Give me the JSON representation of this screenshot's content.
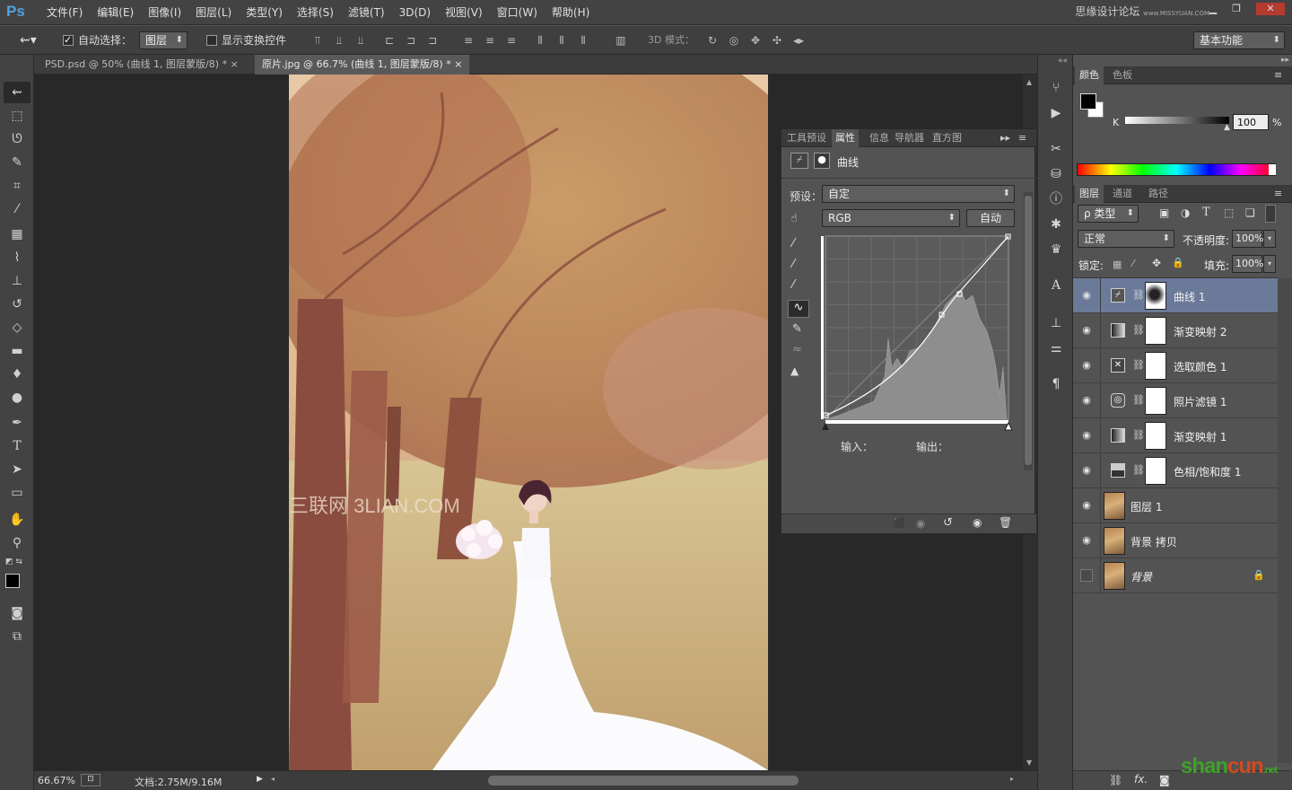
{
  "app": {
    "logo": "Ps"
  },
  "menu": [
    "文件(F)",
    "编辑(E)",
    "图像(I)",
    "图层(L)",
    "类型(Y)",
    "选择(S)",
    "滤镜(T)",
    "3D(D)",
    "视图(V)",
    "窗口(W)",
    "帮助(H)"
  ],
  "watermark": {
    "text": "思缘设计论坛",
    "small": "www.MISSYUAN.COM"
  },
  "options": {
    "auto_select_label": "自动选择：",
    "auto_select_target": "图层",
    "show_transform_label": "显示变换控件",
    "mode3d_label": "3D 模式：",
    "workspace": "基本功能"
  },
  "doc_tabs": [
    {
      "label": "PSD.psd @ 50% (曲线 1, 图层蒙版/8) *"
    },
    {
      "label": "原片.jpg @ 66.7% (曲线 1, 图层蒙版/8) *"
    }
  ],
  "canvas": {
    "watermark_text": "三联网 3LIAN.COM"
  },
  "status": {
    "zoom": "66.67%",
    "doc": "文档:2.75M/9.16M"
  },
  "properties": {
    "tabs": [
      "工具预设",
      "属性",
      "信息",
      "导航器",
      "直方图"
    ],
    "title": "曲线",
    "preset_label": "预设：",
    "preset_value": "自定",
    "channel": "RGB",
    "auto_button": "自动",
    "input_label": "输入：",
    "output_label": "输出："
  },
  "color_panel": {
    "tabs": [
      "颜色",
      "色板"
    ],
    "channel_label": "K",
    "value": "100",
    "unit": "%"
  },
  "layers_panel": {
    "tabs": [
      "图层",
      "通道",
      "路径"
    ],
    "filter": "ρ 类型",
    "blend_mode": "正常",
    "opacity_label": "不透明度:",
    "opacity_value": "100%",
    "lock_label": "锁定:",
    "fill_label": "填充:",
    "fill_value": "100%",
    "layers": [
      {
        "name": "曲线 1",
        "kind": "adjustment",
        "icon": "curves-icon",
        "selected": true,
        "visible": true
      },
      {
        "name": "渐变映射 2",
        "kind": "adjustment",
        "icon": "gradient-map-icon",
        "selected": false,
        "visible": true
      },
      {
        "name": "选取颜色 1",
        "kind": "adjustment",
        "icon": "selective-color-icon",
        "selected": false,
        "visible": true
      },
      {
        "name": "照片滤镜 1",
        "kind": "adjustment",
        "icon": "photo-filter-icon",
        "selected": false,
        "visible": true
      },
      {
        "name": "渐变映射 1",
        "kind": "adjustment",
        "icon": "gradient-map-icon",
        "selected": false,
        "visible": true
      },
      {
        "name": "色相/饱和度 1",
        "kind": "adjustment",
        "icon": "hue-saturation-icon",
        "selected": false,
        "visible": true
      },
      {
        "name": "图层 1",
        "kind": "pixel",
        "selected": false,
        "visible": true
      },
      {
        "name": "背景 拷贝",
        "kind": "pixel",
        "selected": false,
        "visible": true
      },
      {
        "name": "背景",
        "kind": "background",
        "selected": false,
        "visible": false,
        "locked": true
      }
    ]
  },
  "site_logo": {
    "text1": "shan",
    "text2": "cun",
    "suffix": ".net"
  }
}
